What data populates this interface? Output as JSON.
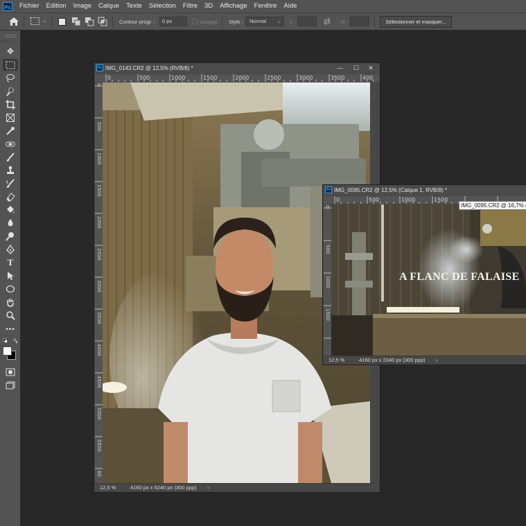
{
  "app": {
    "logo_text": "Ps"
  },
  "menu": [
    "Fichier",
    "Edition",
    "Image",
    "Calque",
    "Texte",
    "Sélection",
    "Filtre",
    "3D",
    "Affichage",
    "Fenêtre",
    "Aide"
  ],
  "options_bar": {
    "contour_label": "Contour progr. :",
    "contour_value": "0 px",
    "lissage_label": "Lissage",
    "style_label": "Style :",
    "style_value": "Normal",
    "width_label": "L :",
    "height_label": "H :",
    "select_mask_button": "Sélectionner et masquer..."
  },
  "documents": [
    {
      "title": "IMG_0143.CR2 @ 12,5% (RVB/8) *",
      "zoom": "12,5 %",
      "dimensions": "4160 px x 6240 px (300 ppp)",
      "ruler_h": [
        "0",
        "500",
        "1000",
        "1500",
        "2000",
        "2500",
        "3000",
        "3500",
        "400"
      ],
      "ruler_v": [
        "0",
        "500",
        "1000",
        "1500",
        "2000",
        "2500",
        "3000",
        "3500",
        "4000",
        "4500",
        "5000",
        "5500",
        "60"
      ]
    },
    {
      "title": "IMG_0095.CR2 @ 12,5% (Calque 1, RVB/8) *",
      "zoom": "12,5 %",
      "dimensions": "4160 px x 2340 px (300 ppp)",
      "ruler_h": [
        "0",
        "500",
        "1000",
        "1500"
      ],
      "ruler_v": [
        "0",
        "500",
        "1000",
        "1500"
      ],
      "overlay_text": "A FLANC DE FALAISE"
    }
  ],
  "tooltip": "IMG_0095.CR2 @ 16,7% (",
  "window_buttons": {
    "minimize": "—",
    "maximize": "☐",
    "close": "✕"
  },
  "status_arrow": "›",
  "colors": {
    "ui_bg": "#535353",
    "workspace": "#282828",
    "accent": "#31a8ff"
  }
}
